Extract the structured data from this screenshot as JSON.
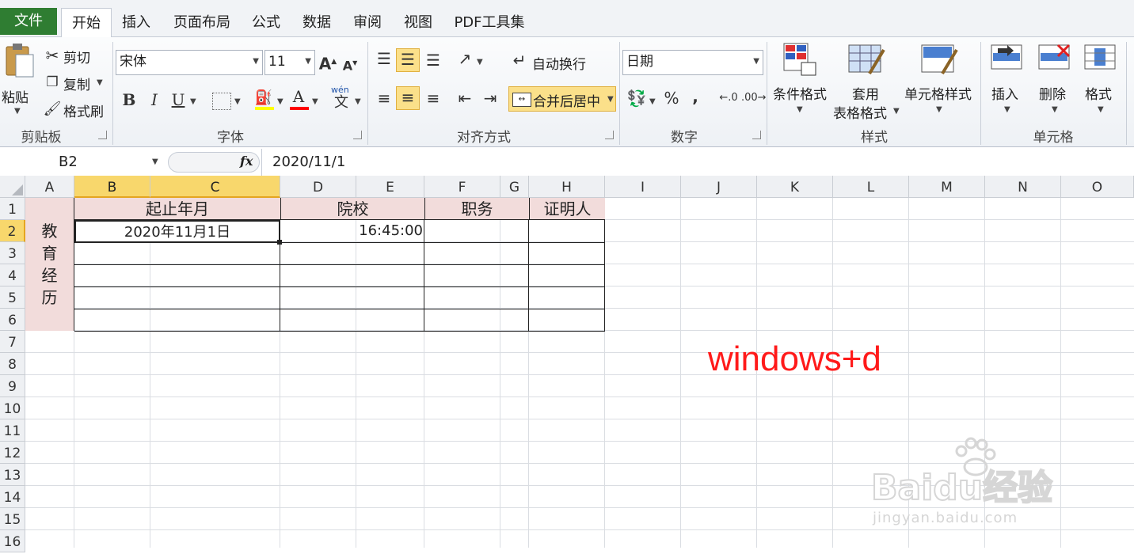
{
  "tabs": {
    "file": "文件",
    "home": "开始",
    "insert": "插入",
    "page_layout": "页面布局",
    "formulas": "公式",
    "data": "数据",
    "review": "审阅",
    "view": "视图",
    "pdf": "PDF工具集"
  },
  "ribbon": {
    "clipboard": {
      "label": "剪贴板",
      "paste": "粘贴",
      "cut": "剪切",
      "copy": "复制",
      "format_painter": "格式刷"
    },
    "font": {
      "label": "字体",
      "font_name": "宋体",
      "font_size": "11",
      "bold": "B",
      "italic": "I",
      "underline": "U",
      "font_color": "A",
      "phonetic": "wén"
    },
    "alignment": {
      "label": "对齐方式",
      "wrap_text": "自动换行",
      "merge_center": "合并后居中"
    },
    "number": {
      "label": "数字",
      "format": "日期",
      "percent": "%",
      "comma": ","
    },
    "styles": {
      "label": "样式",
      "conditional": "条件格式",
      "format_table_1": "套用",
      "format_table_2": "表格格式",
      "cell_styles": "单元格样式"
    },
    "cells": {
      "label": "单元格",
      "insert": "插入",
      "delete": "删除",
      "format": "格式"
    }
  },
  "formula_bar": {
    "name_box": "B2",
    "fx": "fx",
    "value": "2020/11/1"
  },
  "grid": {
    "columns": [
      "A",
      "B",
      "C",
      "D",
      "E",
      "F",
      "G",
      "H",
      "I",
      "J",
      "K",
      "L",
      "M",
      "N",
      "O"
    ],
    "rows": [
      "1",
      "2",
      "3",
      "4",
      "5",
      "6",
      "7",
      "8",
      "9",
      "10",
      "11",
      "12",
      "13",
      "14",
      "15",
      "16"
    ],
    "table": {
      "side_label": [
        "教",
        "育",
        "经",
        "历"
      ],
      "header_period": "起止年月",
      "header_school": "院校",
      "header_position": "职务",
      "header_witness": "证明人",
      "b2_value": "2020年11月1日",
      "d2_value": "16:45:00"
    }
  },
  "annotation": {
    "text": "windows+d",
    "color": "#ff1a1a"
  },
  "watermark": {
    "line1": "Baidu经验",
    "line2": "jingyan.baidu.com"
  },
  "colors": {
    "file_tab": "#2f7d32",
    "selected_header": "#f8d76c",
    "table_fill": "#f2dcdb",
    "highlight_button": "#fbe08a"
  }
}
